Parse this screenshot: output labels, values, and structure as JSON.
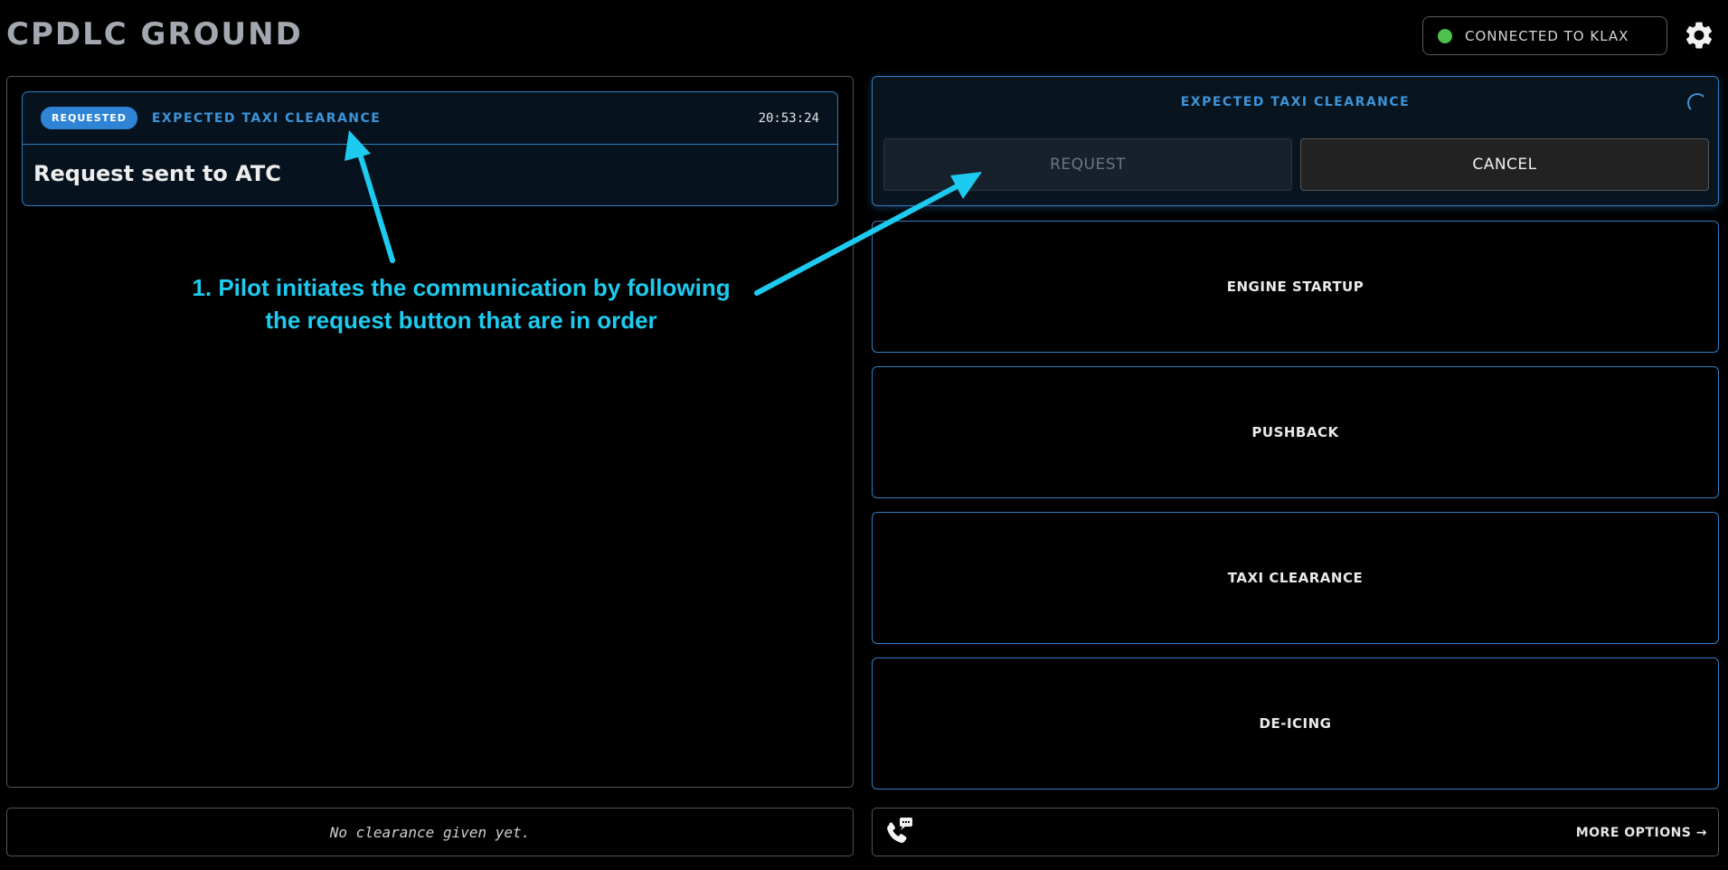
{
  "app": {
    "title": "CPDLC GROUND"
  },
  "status": {
    "text": "CONNECTED TO KLAX",
    "color": "#4cc14c"
  },
  "message": {
    "badge": "REQUESTED",
    "type": "EXPECTED TAXI CLEARANCE",
    "time": "20:53:24",
    "body": "Request sent to ATC"
  },
  "left_footer": {
    "text": "No clearance given yet."
  },
  "active_request": {
    "title": "EXPECTED TAXI CLEARANCE",
    "request_label": "REQUEST",
    "cancel_label": "CANCEL"
  },
  "options": [
    {
      "label": "ENGINE STARTUP"
    },
    {
      "label": "PUSHBACK"
    },
    {
      "label": "TAXI CLEARANCE"
    },
    {
      "label": "DE-ICING"
    }
  ],
  "right_footer": {
    "more_options": "MORE OPTIONS →"
  },
  "annotation": {
    "line1": "1. Pilot initiates the communication by following",
    "line2": "the request button that are in order",
    "color": "#1ecbf0"
  },
  "colors": {
    "accent": "#2f7fc4",
    "background": "#000000"
  },
  "icons": {
    "settings": "gear-icon",
    "phone": "phone-chat-icon",
    "spinner": "loading-spinner-icon"
  }
}
